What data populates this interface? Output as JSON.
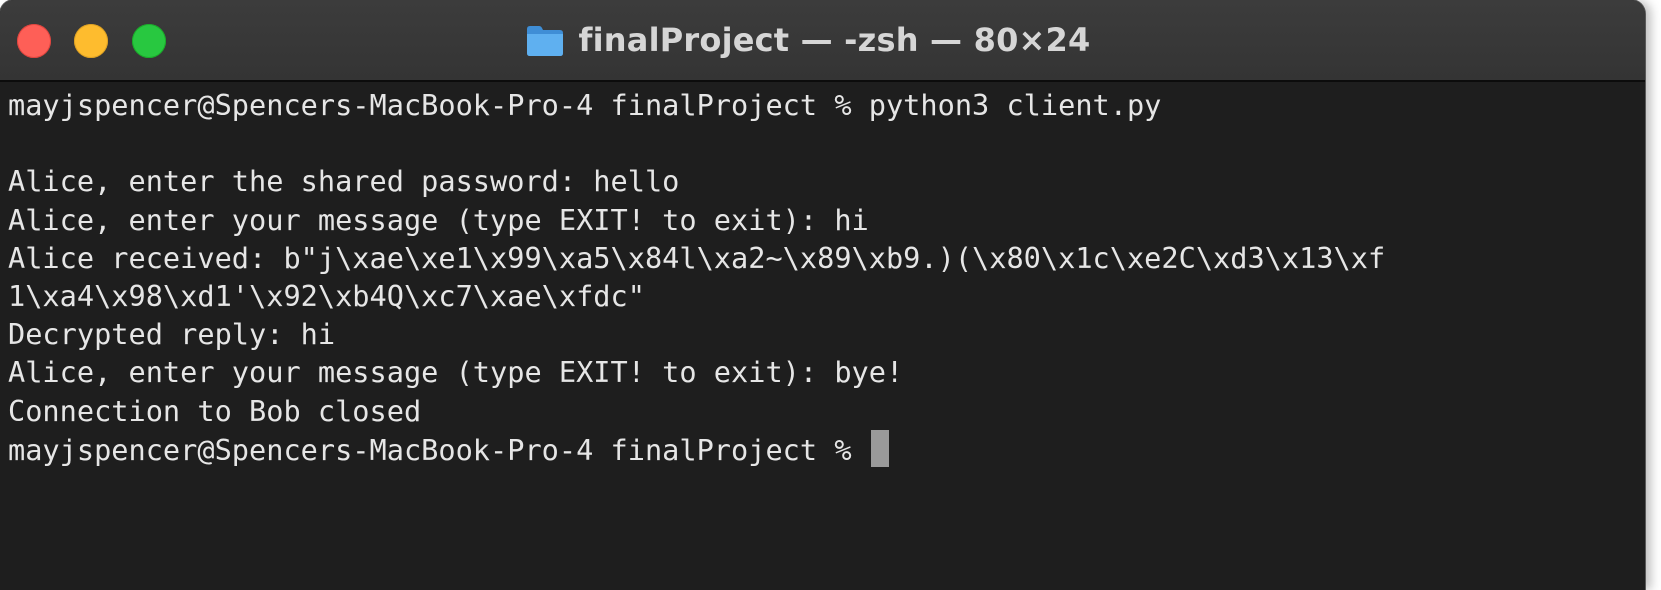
{
  "window": {
    "title": "finalProject — -zsh — 80×24",
    "colors": {
      "background": "#1e1e1e",
      "titlebar": "#383838",
      "text": "#e6e6e6",
      "cursor": "#9a9a9a"
    },
    "traffic_lights": {
      "close": "#fe5f57",
      "minimize": "#febc2e",
      "zoom": "#28c840"
    },
    "title_icon": "folder-icon"
  },
  "terminal": {
    "lines": [
      "mayjspencer@Spencers-MacBook-Pro-4 finalProject % python3 client.py",
      "",
      "Alice, enter the shared password: hello",
      "Alice, enter your message (type EXIT! to exit): hi",
      "Alice received: b\"j\\xae\\xe1\\x99\\xa5\\x84l\\xa2~\\x89\\xb9.)(\\x80\\x1c\\xe2C\\xd3\\x13\\xf",
      "1\\xa4\\x98\\xd1'\\x92\\xb4Q\\xc7\\xae\\xfdc\"",
      "Decrypted reply: hi",
      "Alice, enter your message (type EXIT! to exit): bye!",
      "Connection to Bob closed"
    ],
    "prompt": "mayjspencer@Spencers-MacBook-Pro-4 finalProject % "
  }
}
